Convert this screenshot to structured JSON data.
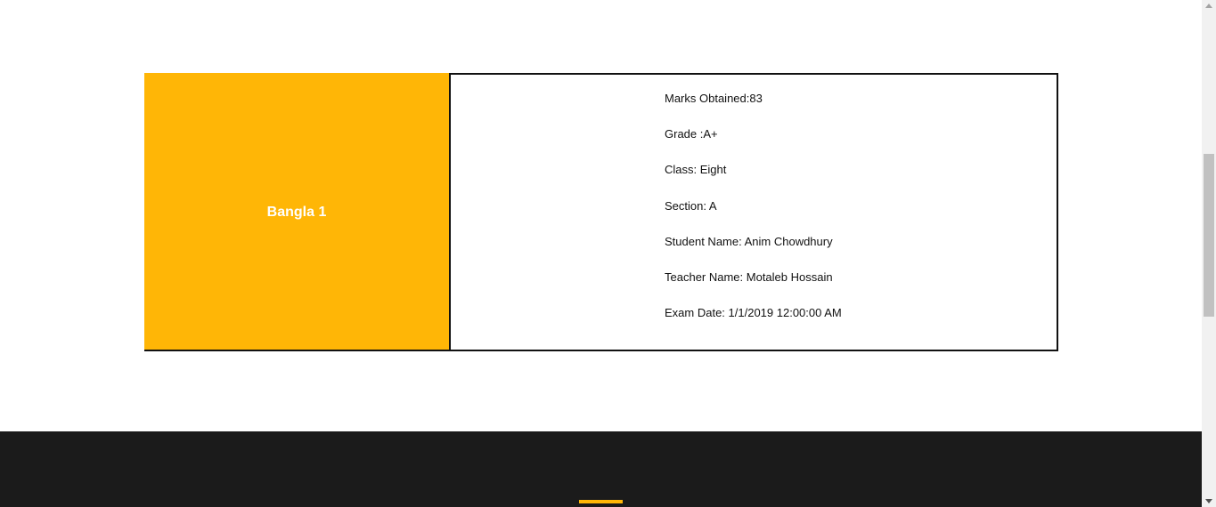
{
  "result": {
    "subject": "Bangla 1",
    "details": [
      "Marks Obtained:83",
      "Grade :A+",
      "Class: Eight",
      "Section: A",
      "Student Name: Anim Chowdhury",
      "Teacher Name: Motaleb Hossain",
      "Exam Date: 1/1/2019 12:00:00 AM"
    ]
  },
  "colors": {
    "accent": "#ffb606",
    "footer_bg": "#1b1b1b",
    "border": "#111111"
  }
}
